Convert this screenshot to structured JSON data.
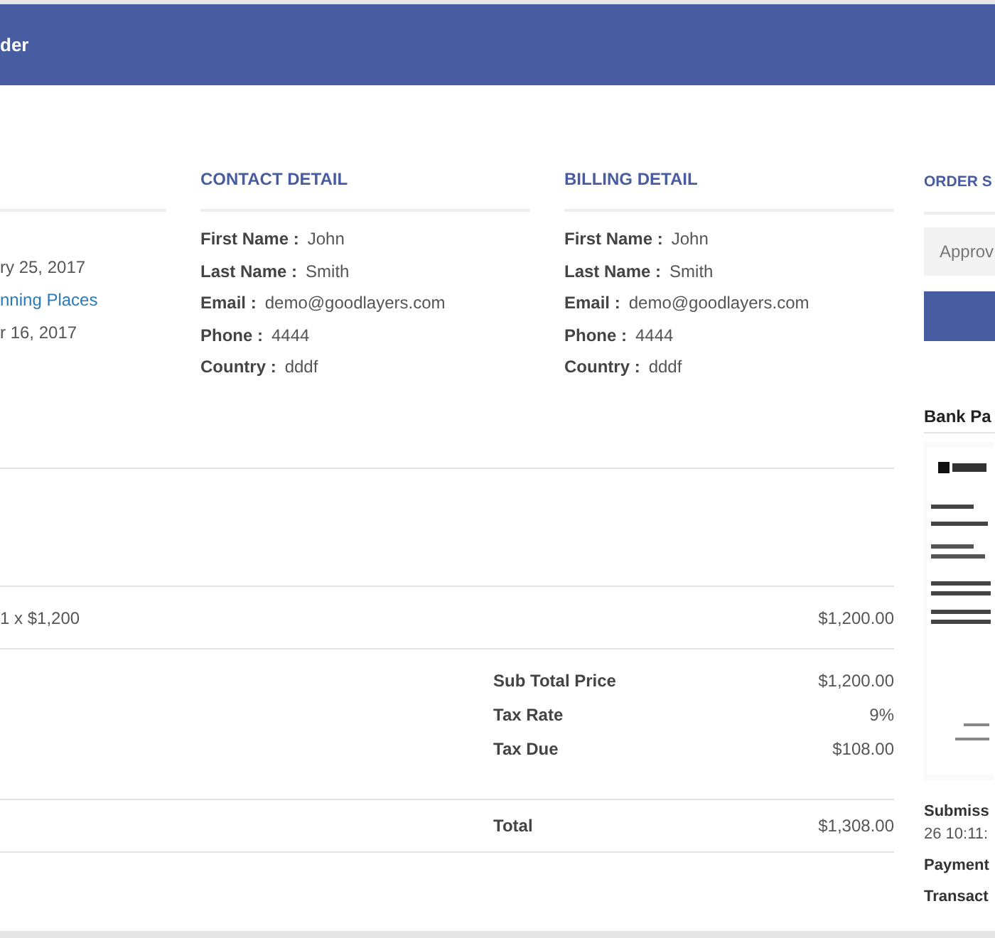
{
  "header": {
    "title": "der"
  },
  "order_info": {
    "lines": [
      {
        "text": "ry 25, 2017",
        "kind": "text"
      },
      {
        "text": "nning Places",
        "kind": "link"
      },
      {
        "text": "r 16, 2017",
        "kind": "text"
      }
    ]
  },
  "contact_detail": {
    "heading": "CONTACT DETAIL",
    "fields": [
      {
        "label": "First Name :",
        "value": "John"
      },
      {
        "label": "Last Name :",
        "value": "Smith"
      },
      {
        "label": "Email :",
        "value": "demo@goodlayers.com"
      },
      {
        "label": "Phone :",
        "value": "4444"
      },
      {
        "label": "Country :",
        "value": "dddf"
      }
    ]
  },
  "billing_detail": {
    "heading": "BILLING DETAIL",
    "fields": [
      {
        "label": "First Name :",
        "value": "John"
      },
      {
        "label": "Last Name :",
        "value": "Smith"
      },
      {
        "label": "Email :",
        "value": "demo@goodlayers.com"
      },
      {
        "label": "Phone :",
        "value": "4444"
      },
      {
        "label": "Country :",
        "value": "dddf"
      }
    ]
  },
  "order_status": {
    "heading": "ORDER S",
    "status_select": {
      "value": "Approv"
    },
    "bank_payment": {
      "heading": "Bank Pa",
      "details": [
        {
          "label": "Submiss",
          "value": "26 10:11:"
        },
        {
          "label": "Payment"
        },
        {
          "label": "Transact"
        }
      ]
    }
  },
  "items": [
    {
      "description": "1 x $1,200",
      "amount": "$1,200.00"
    }
  ],
  "summary": [
    {
      "label": "Sub Total Price",
      "value": "$1,200.00"
    },
    {
      "label": "Tax Rate",
      "value": "9%"
    },
    {
      "label": "Tax Due",
      "value": "$108.00"
    }
  ],
  "total": {
    "label": "Total",
    "value": "$1,308.00"
  }
}
